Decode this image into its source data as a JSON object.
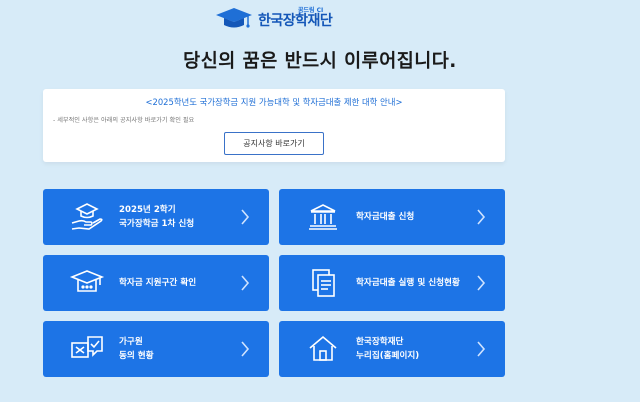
{
  "logo": {
    "tagline": "꿈드림 CI",
    "name": "한국장학재단"
  },
  "headline": "당신의 꿈은 반드시 이루어집니다.",
  "notice": {
    "title": "<2025학년도 국가장학금 지원 가능대학 및 학자금대출 제한 대학 안내>",
    "description": "- 세부적인 사항은 아래의 공지사항 바로가기 확인 필요",
    "button_label": "공지사항 바로가기"
  },
  "cards": [
    {
      "line1": "2025년 2학기",
      "line2": "국가장학금 1차 신청",
      "icon": "graduation-cap-hand-icon"
    },
    {
      "line1": "학자금대출 신청",
      "line2": "",
      "icon": "bank-building-icon"
    },
    {
      "line1": "학자금 지원구간 확인",
      "line2": "",
      "icon": "graduation-cap-chat-icon"
    },
    {
      "line1": "학자금대출 실행 및 신청현황",
      "line2": "",
      "icon": "documents-icon"
    },
    {
      "line1": "가구원",
      "line2": "동의 현황",
      "icon": "consent-check-icon"
    },
    {
      "line1": "한국장학재단",
      "line2": "누리집(홈페이지)",
      "icon": "home-icon"
    }
  ],
  "colors": {
    "background": "#d7ebf8",
    "card": "#1d74e6",
    "accent": "#1f6fd6"
  }
}
